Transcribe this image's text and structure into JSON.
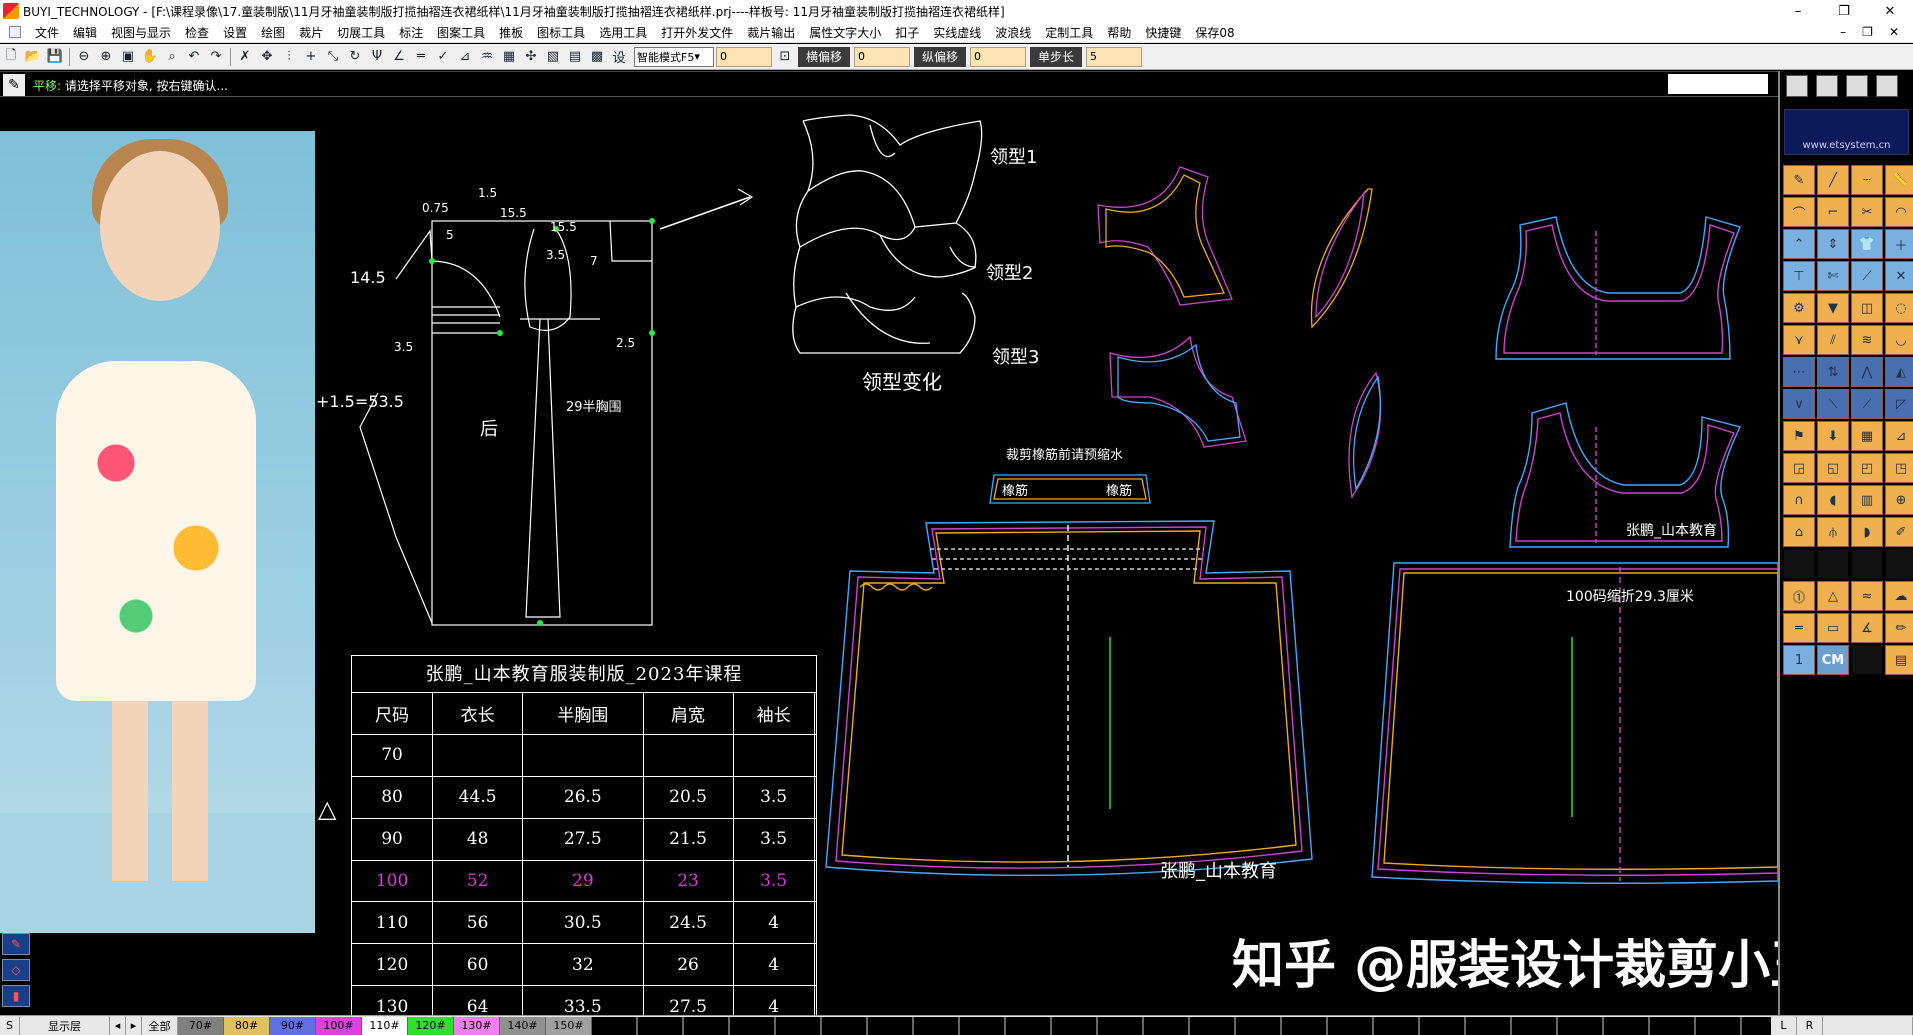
{
  "titlebar": {
    "title": "BUYI_TECHNOLOGY - [F:\\课程录像\\17.童装制版\\11月牙袖童装制版打揽抽褶连衣裙纸样\\11月牙袖童装制版打揽抽褶连衣裙纸样.prj----样板号: 11月牙袖童装制版打揽抽褶连衣裙纸样]",
    "minimize": "–",
    "restore": "❐",
    "close": "✕"
  },
  "menubar": {
    "items": [
      "文件",
      "编辑",
      "视图与显示",
      "检查",
      "设置",
      "绘图",
      "裁片",
      "切展工具",
      "标注",
      "图案工具",
      "推板",
      "图标工具",
      "选用工具",
      "打开外发文件",
      "裁片输出",
      "属性文字大小",
      "扣子",
      "实线虚线",
      "波浪线",
      "定制工具",
      "帮助",
      "快捷键",
      "保存08"
    ],
    "mdi_minimize": "–",
    "mdi_restore": "❐",
    "mdi_close": "✕"
  },
  "toolbar": {
    "mode_select": "智能模式F5",
    "input1": "0",
    "label_h_offset": "横偏移",
    "input_h_offset": "0",
    "label_v_offset": "纵偏移",
    "input_v_offset": "0",
    "label_step": "单步长",
    "input_step": "5"
  },
  "prompt": {
    "prefix": "平移:",
    "text": "请选择平移对象, 按右键确认..."
  },
  "drafting": {
    "neck_labels": [
      "领型1",
      "领型2",
      "领型3"
    ],
    "neck_caption": "领型变化",
    "back_label": "后",
    "dims": [
      "0.75",
      "1.5",
      "15.5",
      "15.5",
      "14.5",
      "2.5",
      "3.5",
      "29半胸围",
      "+1.5=53.5",
      "3.5",
      "5",
      "7"
    ],
    "smock_note": "裁剪橡筋前请预缩水",
    "smock_label": "橡筋",
    "skirt_note_right": "100码缩折29.3厘米",
    "signature": "张鹏_山本教育"
  },
  "size_table": {
    "caption": "张鹏_山本教育服装制版_2023年课程",
    "headers": [
      "尺码",
      "衣长",
      "半胸围",
      "肩宽",
      "袖长",
      ""
    ],
    "rows": [
      [
        "70",
        "",
        "",
        "",
        "",
        ""
      ],
      [
        "80",
        "44.5",
        "26.5",
        "20.5",
        "3.5",
        ""
      ],
      [
        "90",
        "48",
        "27.5",
        "21.5",
        "3.5",
        ""
      ],
      [
        "100",
        "52",
        "29",
        "23",
        "3.5",
        ""
      ],
      [
        "110",
        "56",
        "30.5",
        "24.5",
        "4",
        ""
      ],
      [
        "120",
        "60",
        "32",
        "26",
        "4",
        ""
      ],
      [
        "130",
        "64",
        "33.5",
        "27.5",
        "4",
        ""
      ]
    ],
    "highlight_row": 3,
    "triangle": "△"
  },
  "watermark": "知乎 @服装设计裁剪小玉",
  "rightpanel": {
    "url": "www.etsystem.cn",
    "cm_label": "CM"
  },
  "statusbar": {
    "s_label": "S",
    "layer_label": "显示层",
    "all_label": "全部",
    "sizes": [
      {
        "label": "70#",
        "color": "#808080"
      },
      {
        "label": "80#",
        "color": "#e0c060"
      },
      {
        "label": "90#",
        "color": "#6070e0"
      },
      {
        "label": "100#",
        "color": "#e040e0"
      },
      {
        "label": "110#",
        "color": "#ffffff"
      },
      {
        "label": "120#",
        "color": "#30e030"
      },
      {
        "label": "130#",
        "color": "#f080f0"
      },
      {
        "label": "140#",
        "color": "#909090"
      },
      {
        "label": "150#",
        "color": "#a0a0a0"
      }
    ],
    "l_label": "L",
    "r_label": "R"
  },
  "colors": {
    "white_line": "#ffffff",
    "green_node": "#22ee44",
    "purple_line": "#cc44cc",
    "blue_line": "#4466ff",
    "orange_line": "#ee9922"
  }
}
